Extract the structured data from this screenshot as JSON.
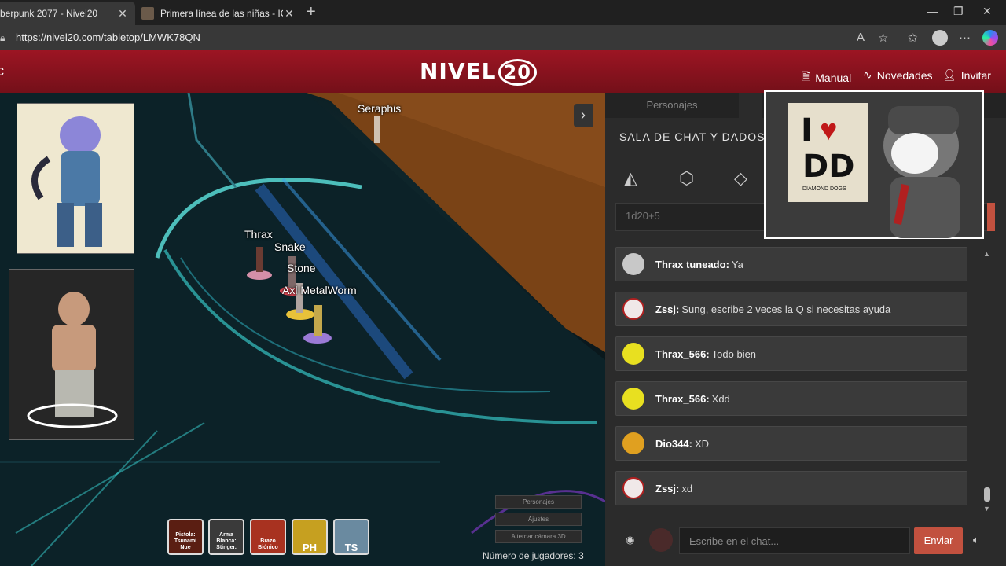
{
  "browser": {
    "tabs": [
      {
        "label": "berpunk 2077 - Nivel20"
      },
      {
        "label": "Primera línea de las niñas - IOP W"
      }
    ],
    "url": "https://nivel20.com/tabletop/LMWK78QN"
  },
  "site": {
    "logo": "NIVEL",
    "logo_num": "20",
    "nav": [
      {
        "label": "Manual",
        "icon": "document-icon"
      },
      {
        "label": "Novedades",
        "icon": "pulse-icon"
      },
      {
        "label": "Invitar",
        "icon": "add-user-icon"
      }
    ]
  },
  "map": {
    "tokens": [
      {
        "label": "Seraphis"
      },
      {
        "label": "Thrax"
      },
      {
        "label": "Snake"
      },
      {
        "label": "Stone"
      },
      {
        "label": "Axl MetalWorm"
      }
    ],
    "actions": [
      {
        "label": "Pistola: Tsunami Nue"
      },
      {
        "label": "Arma Blanca: Stinger."
      },
      {
        "label": "Brazo Biónico"
      },
      {
        "label": "PH"
      },
      {
        "label": "TS"
      }
    ],
    "camera_menu": [
      "Personajes",
      "Ajustes",
      "Alternar cámara 3D"
    ],
    "players": "Número de jugadores: 3"
  },
  "panel": {
    "tab_characters": "Personajes",
    "room_title": "SALA DE CHAT Y DADOS",
    "roll_placeholder": "1d20+5",
    "messages": [
      {
        "who": "Thrax tuneado:",
        "text": "Ya"
      },
      {
        "who": "Zssj:",
        "text": "Sung, escribe 2 veces la Q si necesitas ayuda"
      },
      {
        "who": "Thrax_566:",
        "text": "Todo bien"
      },
      {
        "who": "Thrax_566:",
        "text": "Xdd"
      },
      {
        "who": "Dio344:",
        "text": "XD"
      },
      {
        "who": "Zssj:",
        "text": "xd"
      }
    ],
    "chat_placeholder": "Escribe en el chat...",
    "send_label": "Enviar"
  },
  "webcam": {
    "badge_top": "I",
    "badge_bottom": "DD",
    "badge_caption": "DIAMOND DOGS"
  }
}
